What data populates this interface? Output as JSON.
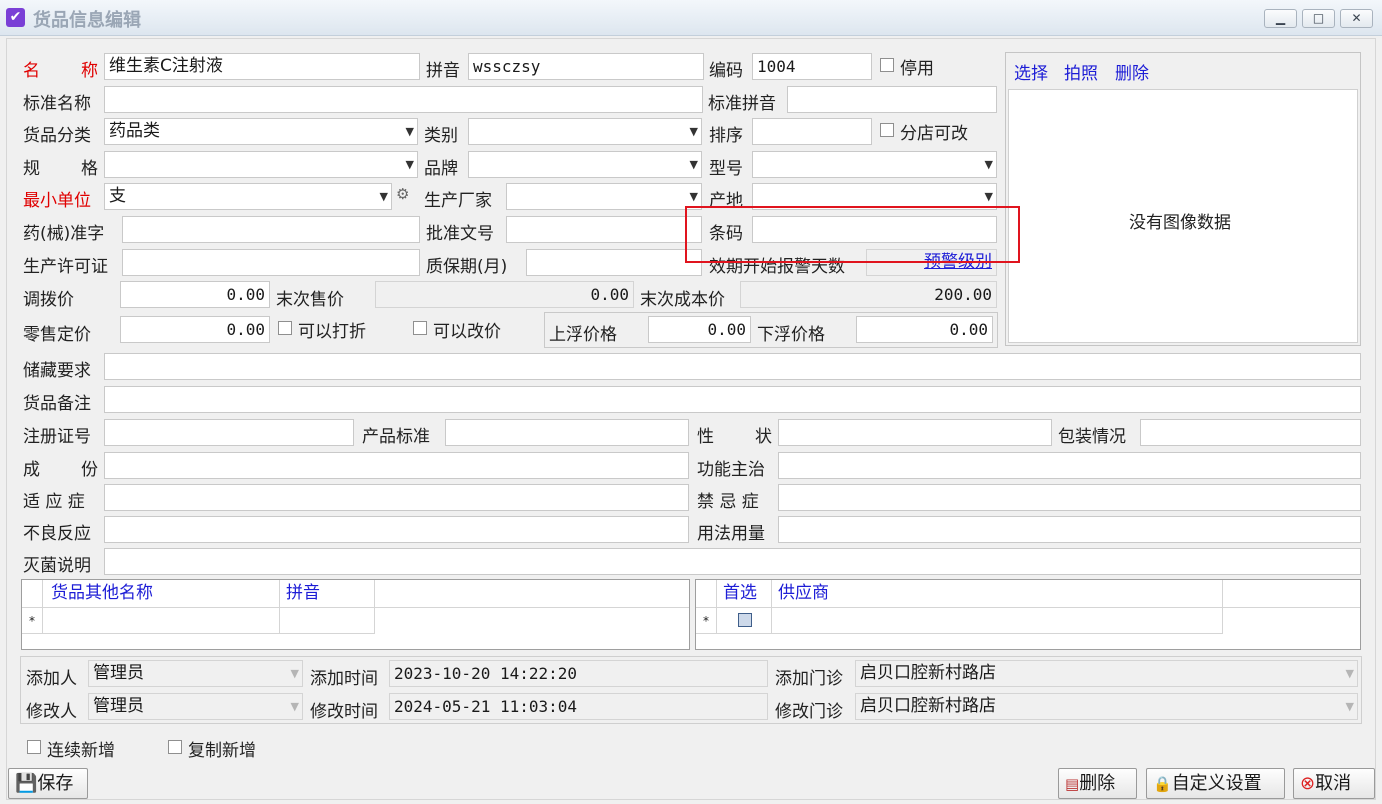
{
  "window": {
    "title": "货品信息编辑",
    "min": "▁",
    "max": "□",
    "close": "✕"
  },
  "row1": {
    "name_label_1": "名",
    "name_label_2": "称",
    "name_value": "维生素C注射液",
    "pinyin_label": "拼音",
    "pinyin_value": "wssczsy",
    "code_label": "编码",
    "code_value": "1004",
    "disabled_label": "停用"
  },
  "row2": {
    "std_name_label": "标准名称",
    "std_name_value": "",
    "std_pinyin_label": "标准拼音",
    "std_pinyin_value": ""
  },
  "row3": {
    "category_label": "货品分类",
    "category_value": "药品类",
    "type_label": "类别",
    "type_value": "",
    "order_label": "排序",
    "order_value": "",
    "branch_label": "分店可改"
  },
  "row4": {
    "spec_label_1": "规",
    "spec_label_2": "格",
    "spec_value": "",
    "brand_label": "品牌",
    "brand_value": "",
    "model_label": "型号",
    "model_value": ""
  },
  "row5": {
    "unit_label": "最小单位",
    "unit_value": "支",
    "maker_label": "生产厂家",
    "maker_value": "",
    "origin_label": "产地",
    "origin_value": ""
  },
  "row6": {
    "approval_label": "药(械)准字",
    "approval_value": "",
    "doc_label": "批准文号",
    "doc_value": "",
    "barcode_label": "条码",
    "barcode_value": ""
  },
  "row7": {
    "license_label": "生产许可证",
    "license_value": "",
    "shelf_label": "质保期(月)",
    "shelf_value": "",
    "alarm_label": "效期开始报警天数",
    "alarm_link": "预警级别"
  },
  "row8": {
    "transfer_label": "调拨价",
    "transfer_value": "0.00",
    "last_sale_label": "末次售价",
    "last_sale_value": "0.00",
    "last_cost_label": "末次成本价",
    "last_cost_value": "200.00"
  },
  "row9": {
    "retail_label": "零售定价",
    "retail_value": "0.00",
    "discount_label": "可以打折",
    "changeprice_label": "可以改价",
    "up_label": "上浮价格",
    "up_value": "0.00",
    "down_label": "下浮价格",
    "down_value": "0.00"
  },
  "photo": {
    "select": "选择",
    "shoot": "拍照",
    "delete": "删除",
    "empty": "没有图像数据"
  },
  "details": {
    "storage_label": "储藏要求",
    "note_label": "货品备注",
    "reg_label": "注册证号",
    "product_std_label": "产品标准",
    "prop_label_1": "性",
    "prop_label_2": "状",
    "pack_label": "包装情况",
    "ingredient_label_1": "成",
    "ingredient_label_2": "份",
    "function_label": "功能主治",
    "indication_label": "适 应 症",
    "contra_label": "禁 忌 症",
    "adverse_label": "不良反应",
    "usage_label": "用法用量",
    "sterile_label": "灭菌说明"
  },
  "alias_grid": {
    "columns": [
      "货品其他名称",
      "拼音"
    ],
    "new_row_marker": "*"
  },
  "supplier_grid": {
    "columns": [
      "首选",
      "供应商"
    ],
    "new_row_marker": "*"
  },
  "audit": {
    "add_user_label": "添加人",
    "add_user_value": "管理员",
    "add_time_label": "添加时间",
    "add_time_value": "2023-10-20 14:22:20",
    "add_clinic_label": "添加门诊",
    "add_clinic_value": "启贝口腔新村路店",
    "mod_user_label": "修改人",
    "mod_user_value": "管理员",
    "mod_time_label": "修改时间",
    "mod_time_value": "2024-05-21 11:03:04",
    "mod_clinic_label": "修改门诊",
    "mod_clinic_value": "启贝口腔新村路店"
  },
  "options": {
    "continuous_add": "连续新增",
    "copy_add": "复制新增"
  },
  "buttons": {
    "save": "保存",
    "delete": "删除",
    "custom": "自定义设置",
    "cancel": "取消"
  }
}
